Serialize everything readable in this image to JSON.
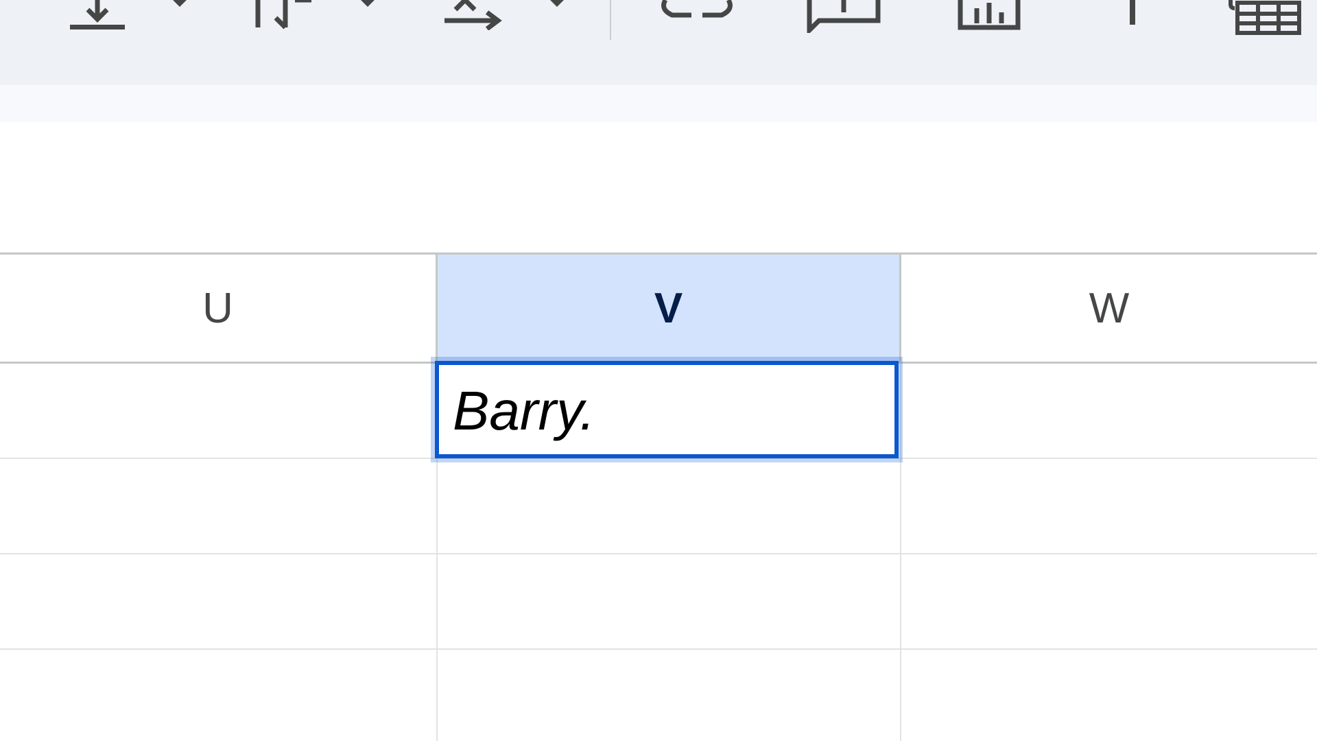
{
  "toolbar": {
    "icons": [
      "download-icon",
      "text-wrap-icon",
      "text-rotation-icon",
      "link-icon",
      "comment-icon",
      "chart-icon",
      "filter-icon",
      "table-icon"
    ]
  },
  "grid": {
    "columns": [
      "U",
      "V",
      "W"
    ],
    "selected_column": "V",
    "rows": [
      [
        "",
        "Barry.",
        ""
      ],
      [
        "",
        "",
        ""
      ],
      [
        "",
        "",
        ""
      ],
      [
        "",
        "",
        ""
      ]
    ]
  },
  "colors": {
    "toolbar_bg": "#eef2f6",
    "selected_header_bg": "#d3e3fd",
    "selection_border": "#0b57d0"
  }
}
